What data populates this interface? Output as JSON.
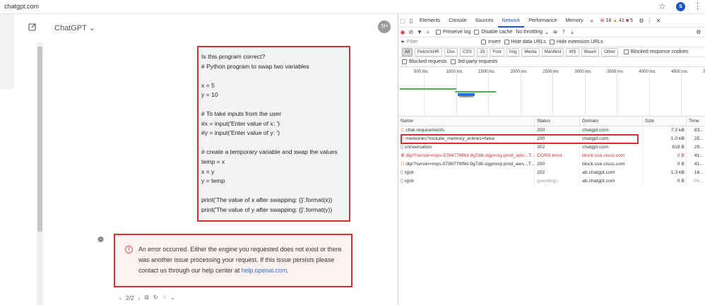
{
  "browser": {
    "url": "chatgpt.com",
    "profile_initial": "S"
  },
  "chat": {
    "title": "ChatGPT",
    "user_initials": "SH",
    "message_lines": [
      "Is this program correct?",
      "# Python program to swap two variables",
      "",
      "x = 5",
      "y = 10",
      "",
      "# To take inputs from the user",
      "#x = input('Enter value of x: ')",
      "#y = input('Enter value of y: ')",
      "",
      "# create a temporary variable and swap the values",
      "temp = x",
      "x = y",
      "y = temp",
      "",
      "print('The value of x after swapping: {}'.format(x))",
      "print('The value of y after swapping: {}'.format(y))"
    ],
    "error_text": "An error occurred. Either the engine you requested does not exist or there was another issue processing your request. If this issue persists please contact us through our help center at ",
    "error_link": "help.openai.com",
    "error_suffix": ".",
    "pager": "2/2"
  },
  "devtools": {
    "tabs": [
      "Elements",
      "Console",
      "Sources",
      "Network",
      "Performance",
      "Memory"
    ],
    "active_tab": "Network",
    "counts": {
      "errors": "18",
      "warnings": "41",
      "issues": "5"
    },
    "preserve_log": "Preserve log",
    "disable_cache": "Disable cache",
    "throttling": "No throttling",
    "filter_placeholder": "Filter",
    "invert": "Invert",
    "hide_data": "Hide data URLs",
    "hide_ext": "Hide extension URLs",
    "types": [
      "All",
      "Fetch/XHR",
      "Doc",
      "CSS",
      "JS",
      "Font",
      "Img",
      "Media",
      "Manifest",
      "WS",
      "Wasm",
      "Other"
    ],
    "blocked_cookies": "Blocked response cookies",
    "blocked_requests": "Blocked requests",
    "third_party": "3rd-party requests",
    "timeline_ticks": [
      "500 ms",
      "1000 ms",
      "1500 ms",
      "2000 ms",
      "2500 ms",
      "3000 ms",
      "3500 ms",
      "4000 ms",
      "4500 ms",
      "5"
    ],
    "columns": [
      "Name",
      "Status",
      "Domain",
      "Size",
      "Time"
    ],
    "rows": [
      {
        "name": "chat-requirements",
        "status": "200",
        "domain": "chatgpt.com",
        "size": "7.3 kB",
        "time": "83..."
      },
      {
        "name": "memories?include_memory_entries=false",
        "status": "200",
        "domain": "chatgpt.com",
        "size": "1.0 kB",
        "time": "25..."
      },
      {
        "name": "conversation",
        "status": "302",
        "domain": "chatgpt.com",
        "size": "819 B",
        "time": "29..."
      },
      {
        "name": "dlp/?server=mps-5786776f9d-9g7d8.sigproxy.prod_aws...T...",
        "status": "CORS error",
        "domain": "block.sse.cisco.com",
        "size": "0 B",
        "time": "41..."
      },
      {
        "name": "dlp/?server=mps-5786776f9d-9g7d8.sigproxy.prod_aws...T...",
        "status": "200",
        "domain": "block.sse.cisco.com",
        "size": "0 B",
        "time": "41..."
      },
      {
        "name": "rgstr",
        "status": "202",
        "domain": "ab.chatgpt.com",
        "size": "1.3 kB",
        "time": "16..."
      },
      {
        "name": "rgstr",
        "status": "(pending)",
        "domain": "ab.chatgpt.com",
        "size": "0 B",
        "time": "Pe..."
      }
    ]
  }
}
